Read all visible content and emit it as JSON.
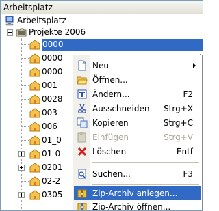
{
  "panel": {
    "title": "Arbeitsplatz"
  },
  "tree": {
    "root_label": "Arbeitsplatz",
    "project_label": "Projekte 2006",
    "folders": [
      {
        "label": "0000",
        "selected": true
      },
      {
        "label": "0000"
      },
      {
        "label": "0000"
      },
      {
        "label": "001"
      },
      {
        "label": "0028"
      },
      {
        "label": "003"
      },
      {
        "label": "006"
      },
      {
        "label": "01_0"
      },
      {
        "label": "01-0"
      },
      {
        "label": "0201"
      },
      {
        "label": "02-2"
      },
      {
        "label": "0305"
      }
    ],
    "clipped_right_fragments": [
      "h",
      "m",
      "ne",
      "ll",
      "u",
      "V",
      "ec",
      "ca"
    ]
  },
  "context_menu": {
    "items": [
      {
        "label": "Neu",
        "shortcut": "",
        "icon": "new-document-icon",
        "submenu": true
      },
      {
        "label": "Öffnen...",
        "shortcut": "",
        "icon": "open-folder-icon"
      },
      {
        "label": "Ändern...",
        "shortcut": "F2",
        "icon": "edit-icon"
      },
      {
        "label": "Ausschneiden",
        "shortcut": "Strg+X",
        "icon": "scissors-icon"
      },
      {
        "label": "Kopieren",
        "shortcut": "Strg+C",
        "icon": "copy-icon"
      },
      {
        "label": "Einfügen",
        "shortcut": "Strg+V",
        "icon": "paste-icon",
        "disabled": true
      },
      {
        "label": "Löschen",
        "shortcut": "Entf",
        "icon": "delete-icon"
      },
      {
        "label": "Suchen...",
        "shortcut": "F3",
        "icon": "search-icon"
      },
      {
        "label": "Zip-Archiv anlegen...",
        "shortcut": "",
        "icon": "zip-create-icon",
        "highlighted": true
      },
      {
        "label": "Zip-Archiv öffnen...",
        "shortcut": "",
        "icon": "zip-open-icon"
      }
    ]
  },
  "colors": {
    "selection": "#316ac5",
    "disabled_text": "#aca899",
    "frame_border": "#7f9db9"
  }
}
